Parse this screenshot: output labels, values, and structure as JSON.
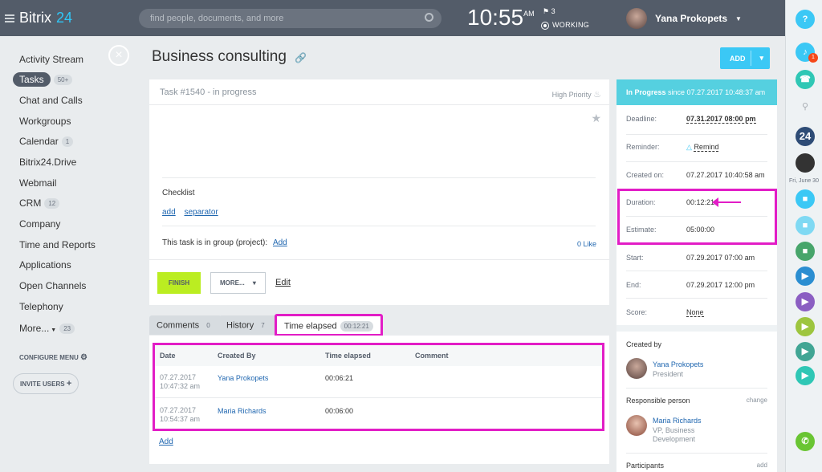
{
  "topbar": {
    "brand": "Bitrix",
    "brand_num": "24",
    "search_placeholder": "find people, documents, and more",
    "time": "10:55",
    "ampm": "AM",
    "flag_count": "3",
    "status": "WORKING",
    "user_name": "Yana Prokopets"
  },
  "sidebar": {
    "items": [
      {
        "label": "Activity Stream"
      },
      {
        "label": "Tasks",
        "count": "50+"
      },
      {
        "label": "Chat and Calls"
      },
      {
        "label": "Workgroups"
      },
      {
        "label": "Calendar",
        "count": "1"
      },
      {
        "label": "Bitrix24.Drive"
      },
      {
        "label": "Webmail"
      },
      {
        "label": "CRM",
        "count": "12"
      },
      {
        "label": "Company"
      },
      {
        "label": "Time and Reports"
      },
      {
        "label": "Applications"
      },
      {
        "label": "Open Channels"
      },
      {
        "label": "Telephony"
      },
      {
        "label": "More...",
        "count": "23"
      }
    ],
    "configure": "CONFIGURE MENU",
    "invite": "INVITE USERS"
  },
  "page": {
    "title": "Business consulting",
    "add_button": "ADD"
  },
  "task": {
    "header": "Task #1540 - in progress",
    "priority": "High Priority",
    "checklist_title": "Checklist",
    "checklist_add": "add",
    "checklist_separator": "separator",
    "group_text": "This task is in group (project):",
    "group_add": "Add",
    "likes": "0",
    "like_label": "Like",
    "finish": "FINISH",
    "more": "MORE...",
    "edit": "Edit"
  },
  "tabs": [
    {
      "label": "Comments",
      "count": "0"
    },
    {
      "label": "History",
      "count": "7"
    },
    {
      "label": "Time elapsed",
      "count": "00:12:21"
    }
  ],
  "elapsed_table": {
    "headers": [
      "Date",
      "Created By",
      "Time elapsed",
      "Comment"
    ],
    "rows": [
      {
        "date": "07.27.2017",
        "time": "10:47:32 am",
        "by": "Yana Prokopets",
        "elapsed": "00:06:21",
        "comment": ""
      },
      {
        "date": "07.27.2017",
        "time": "10:54:37 am",
        "by": "Maria Richards",
        "elapsed": "00:06:00",
        "comment": ""
      }
    ],
    "add": "Add"
  },
  "side": {
    "status_bold": "In Progress",
    "status_since": "since 07.27.2017 10:48:37 am",
    "fields": [
      {
        "k": "Deadline:",
        "v": "07.31.2017 08:00 pm"
      },
      {
        "k": "Reminder:",
        "v": "Remind"
      },
      {
        "k": "Created on:",
        "v": "07.27.2017 10:40:58 am"
      },
      {
        "k": "Duration:",
        "v": "00:12:21"
      },
      {
        "k": "Estimate:",
        "v": "05:00:00"
      },
      {
        "k": "Start:",
        "v": "07.29.2017 07:00 am"
      },
      {
        "k": "End:",
        "v": "07.29.2017 12:00 pm"
      },
      {
        "k": "Score:",
        "v": "None"
      }
    ],
    "created_by_label": "Created by",
    "creator_name": "Yana Prokopets",
    "creator_title": "President",
    "responsible_label": "Responsible person",
    "change": "change",
    "responsible_name": "Maria Richards",
    "responsible_title1": "VP, Business",
    "responsible_title2": "Development",
    "participants_label": "Participants",
    "participants_add": "add"
  },
  "rightbar": {
    "help": "?",
    "notif_count": "1",
    "day_label": "Fri, June 30",
    "badge24": "24"
  }
}
